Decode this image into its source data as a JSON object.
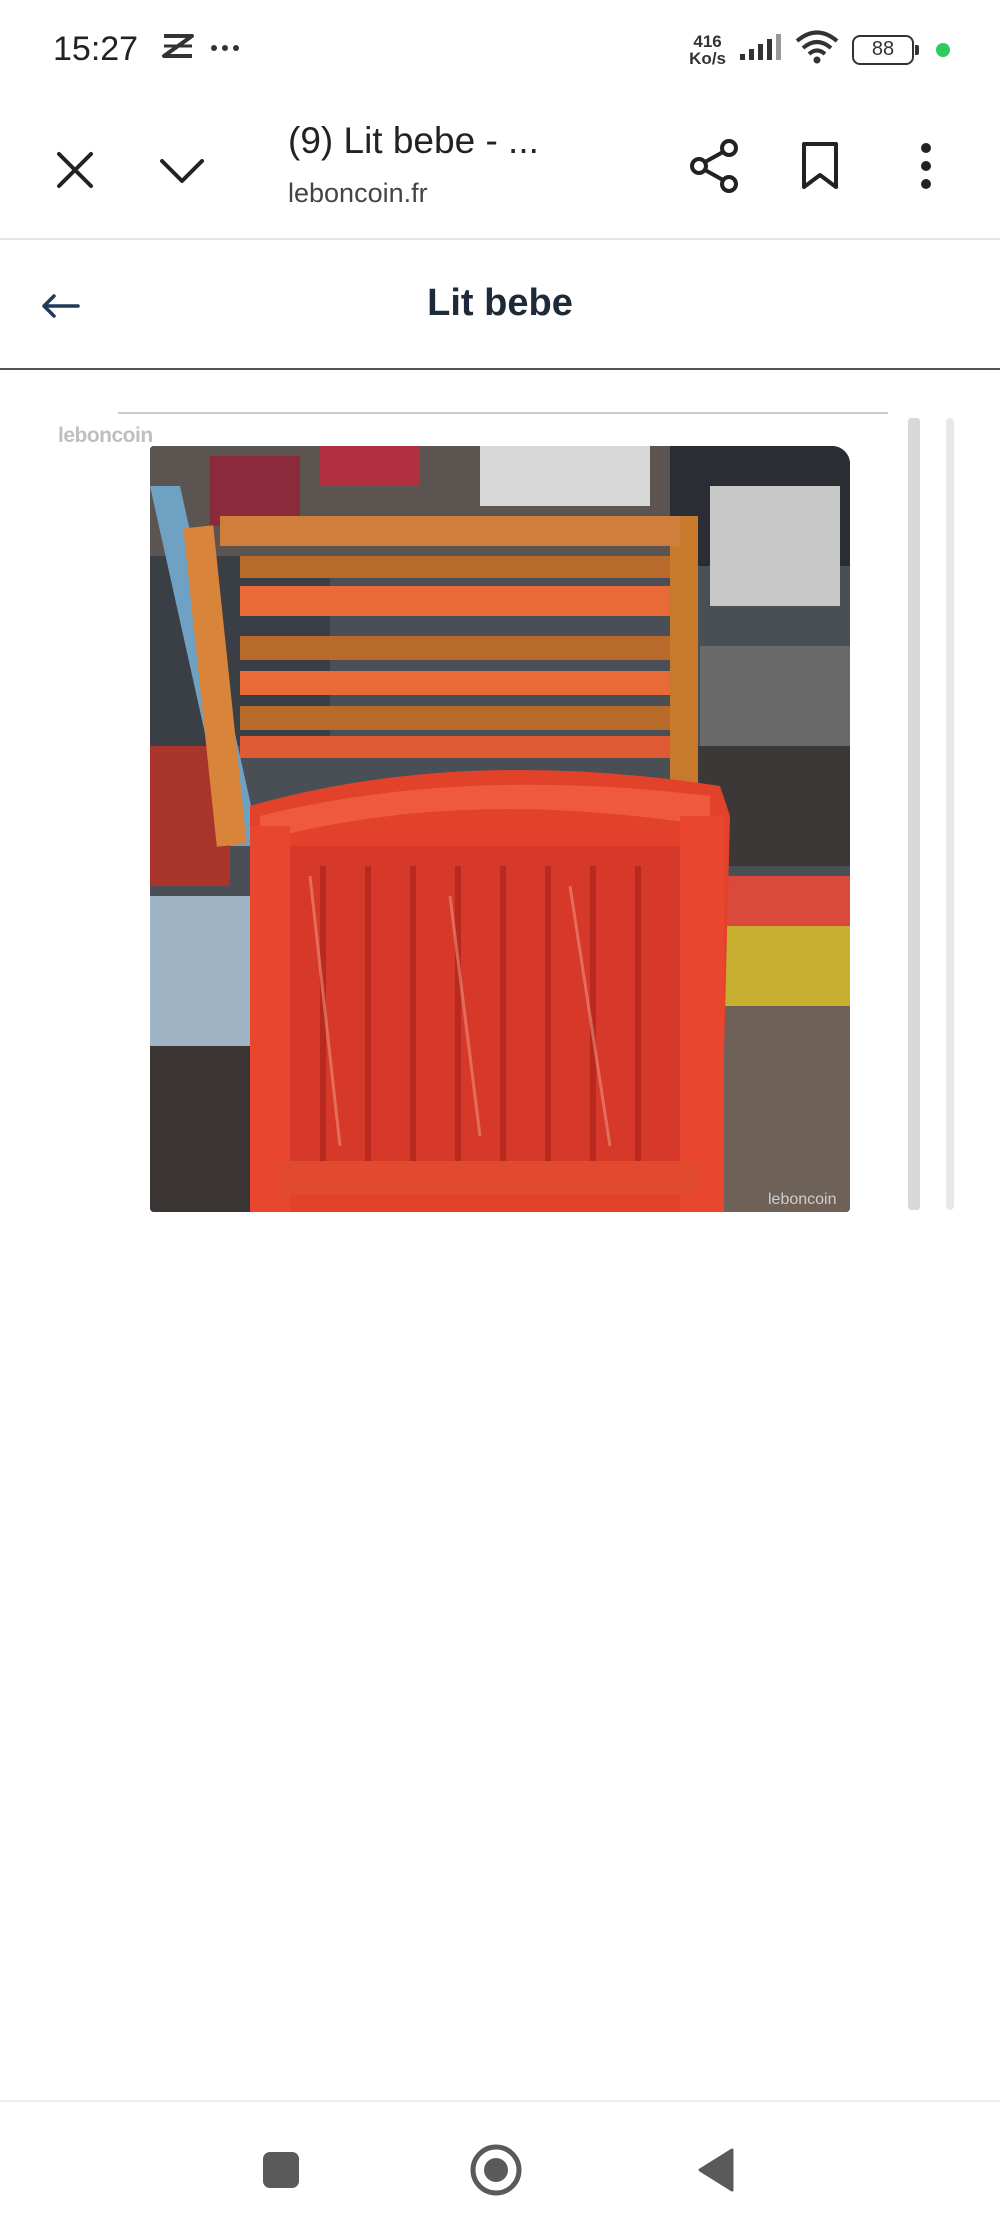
{
  "status_bar": {
    "time": "15:27",
    "net_speed_value": "416",
    "net_speed_unit": "Ko/s",
    "battery": "88",
    "indicator_color": "#2ecc5f"
  },
  "browser": {
    "tab_title": "(9) Lit bebe - ...",
    "url": "leboncoin.fr",
    "icons": [
      "close-icon",
      "chevron-down-icon",
      "share-icon",
      "bookmark-icon",
      "more-vert-icon"
    ]
  },
  "page": {
    "title": "Lit bebe"
  },
  "gallery": {
    "watermark_top": "leboncoin",
    "watermark_bottom": "leboncoin",
    "photo_subject": "red painted wooden baby bed"
  },
  "nav_bar": {
    "icons": [
      "recents-icon",
      "home-icon",
      "back-icon"
    ]
  }
}
